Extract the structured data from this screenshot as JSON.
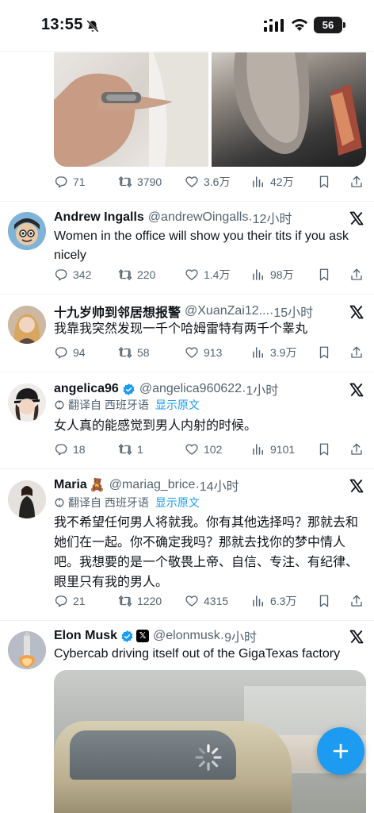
{
  "status_bar": {
    "time": "13:55",
    "battery": "56"
  },
  "colors": {
    "accent": "#1d9bf0",
    "text_primary": "#0f1419",
    "text_secondary": "#536471",
    "divider": "#eff3f4"
  },
  "tweets": [
    {
      "stats": {
        "replies": "71",
        "retweets": "3790",
        "likes": "3.6万",
        "views": "42万"
      }
    },
    {
      "name": "Andrew Ingalls",
      "handle": "@andrewOingalls",
      "time": "·12小时",
      "text": "Women in the office will show you their tits if you ask nicely",
      "stats": {
        "replies": "342",
        "retweets": "220",
        "likes": "1.4万",
        "views": "98万"
      }
    },
    {
      "name": "十九岁帅到邻居想报警",
      "handle": "@XuanZai12...",
      "time": "·15小时",
      "text": "我靠我突然发现一千个哈姆雷特有两千个睾丸",
      "stats": {
        "replies": "94",
        "retweets": "58",
        "likes": "913",
        "views": "3.9万"
      }
    },
    {
      "name": "angelica96",
      "handle": "@angelica960622",
      "time": "·1小时",
      "translated_from": "翻译自 西班牙语",
      "show_original": "显示原文",
      "text": "女人真的能感觉到男人内射的时候。",
      "stats": {
        "replies": "18",
        "retweets": "1",
        "likes": "102",
        "views": "9101"
      }
    },
    {
      "name": "Maria",
      "handle": "@mariag_brice",
      "time": "·14小时",
      "translated_from": "翻译自 西班牙语",
      "show_original": "显示原文",
      "text": "我不希望任何男人将就我。你有其他选择吗？那就去和她们在一起。你不确定我吗？那就去找你的梦中情人吧。我想要的是一个敬畏上帝、自信、专注、有纪律、眼里只有我的男人。",
      "stats": {
        "replies": "21",
        "retweets": "1220",
        "likes": "4315",
        "views": "6.3万"
      }
    },
    {
      "name": "Elon Musk",
      "handle": "@elonmusk",
      "time": "·9小时",
      "text": "Cybercab driving itself out of the GigaTexas factory"
    }
  ],
  "icons": {
    "reply": "reply-icon",
    "retweet": "retweet-icon",
    "like": "heart-icon",
    "views": "views-icon",
    "bookmark": "bookmark-icon",
    "share": "share-icon",
    "x": "x-logo-icon",
    "compose": "plus-icon"
  }
}
